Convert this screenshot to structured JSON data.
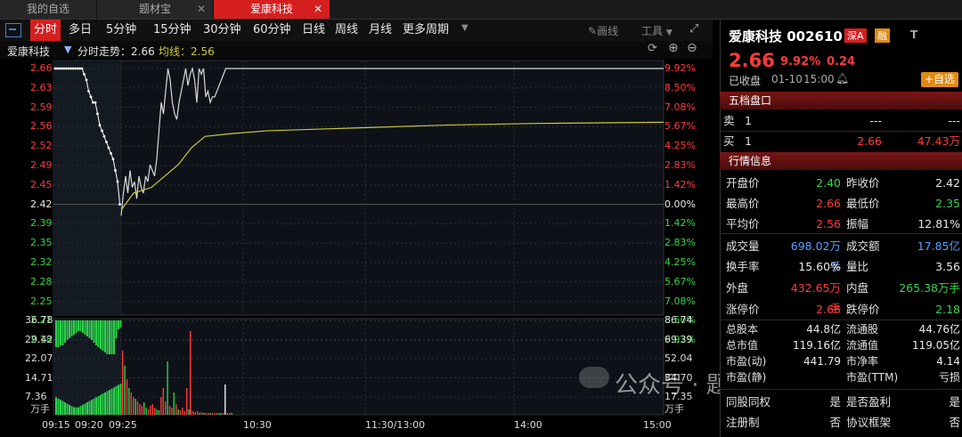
{
  "tabs": [
    {
      "label": "我的自选"
    },
    {
      "label": "题材宝"
    },
    {
      "label": "爱康科技"
    }
  ],
  "periods": [
    "分时",
    "多日",
    "5分钟",
    "15分钟",
    "30分钟",
    "60分钟",
    "日线",
    "周线",
    "月线",
    "更多周期"
  ],
  "toolbar_right": {
    "draw": "画线",
    "tools": "工具"
  },
  "chart": {
    "stock_name": "爱康科技",
    "trend_label": "分时走势：2.66",
    "avg_label": "均线：2.56",
    "price_ticks": [
      "2.66",
      "2.63",
      "2.59",
      "2.56",
      "2.52",
      "2.49",
      "2.45",
      "2.42",
      "2.39",
      "2.35",
      "2.32",
      "2.28",
      "2.25",
      "2.21",
      "2.18"
    ],
    "pct_ticks": [
      "9.92%",
      "8.50%",
      "7.08%",
      "5.67%",
      "4.25%",
      "2.83%",
      "1.42%",
      "0.00%",
      "1.42%",
      "2.83%",
      "4.25%",
      "5.67%",
      "7.08%",
      "8.50%",
      "9.92%"
    ],
    "vol_ticks_left": [
      "36.78",
      "29.42",
      "22.07",
      "14.71",
      "7.36"
    ],
    "vol_ticks_right": [
      "86.74",
      "69.39",
      "52.04",
      "34.70",
      "17.35"
    ],
    "vol_unit": "万手",
    "time_ticks": [
      "09:15",
      "09:20",
      "09:25",
      "10:30",
      "11:30/13:00",
      "14:00",
      "15:00"
    ]
  },
  "quote": {
    "name_code": "爱康科技 002610",
    "badge_market": "深A",
    "badge_type": "融",
    "badge_t": "T",
    "price": "2.66",
    "pct": "9.92%",
    "change": "0.24",
    "status": "已收盘",
    "date": "01-10",
    "time": "15:00",
    "add_btn": "+自选"
  },
  "level5": {
    "title": "五档盘口",
    "sell_label": "卖",
    "buy_label": "买",
    "sell_row": {
      "level": "1",
      "price": "---",
      "vol": "---"
    },
    "buy_row": {
      "level": "1",
      "price": "2.66",
      "vol": "47.43万"
    }
  },
  "info": {
    "title": "行情信息",
    "rows": [
      {
        "l1": "开盘价",
        "v1": "2.40",
        "l2": "昨收价",
        "v2": "2.42"
      },
      {
        "l1": "最高价",
        "v1": "2.66",
        "l2": "最低价",
        "v2": "2.35"
      },
      {
        "l1": "平均价",
        "v1": "2.56",
        "l2": "振幅",
        "v2": "12.81%"
      },
      {
        "l1": "成交量",
        "v1": "698.02万手",
        "l2": "成交额",
        "v2": "17.85亿"
      },
      {
        "l1": "换手率",
        "v1": "15.60%",
        "l2": "量比",
        "v2": "3.56"
      },
      {
        "l1": "外盘",
        "v1": "432.65万手",
        "l2": "内盘",
        "v2": "265.38万手"
      },
      {
        "l1": "涨停价",
        "v1": "2.66",
        "l2": "跌停价",
        "v2": "2.18"
      },
      {
        "l1": "总股本",
        "v1": "44.8亿",
        "l2": "流通股",
        "v2": "44.76亿"
      },
      {
        "l1": "总市值",
        "v1": "119.16亿",
        "l2": "流通值",
        "v2": "119.05亿"
      },
      {
        "l1": "市盈(动)",
        "v1": "441.79",
        "l2": "市净率",
        "v2": "4.14"
      },
      {
        "l1": "市盈(静)",
        "v1": "",
        "l2": "市盈(TTM)",
        "v2": "亏损"
      },
      {
        "l1": "同股同权",
        "v1": "是",
        "l2": "是否盈利",
        "v2": "是"
      },
      {
        "l1": "注册制",
        "v1": "否",
        "l2": "协议框架",
        "v2": "否"
      }
    ]
  },
  "watermark": "公众号 · 题材提升"
}
